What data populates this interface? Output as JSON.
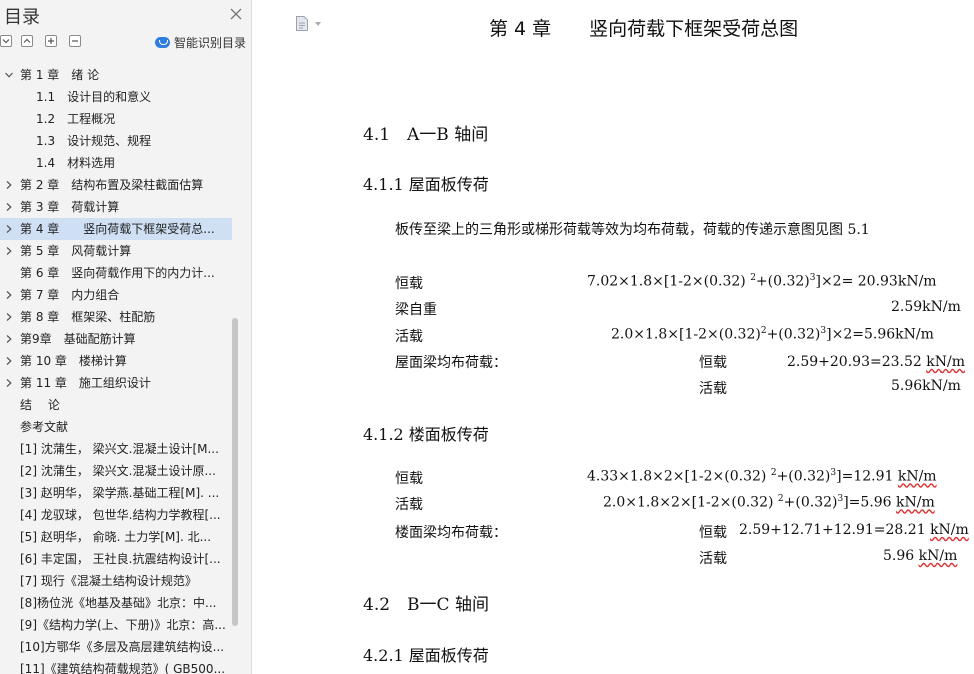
{
  "sidebar": {
    "title": "目录",
    "smart_label": "智能识别目录",
    "items": [
      {
        "text": "第 1 章　绪  论",
        "level": 0,
        "chevron": "down"
      },
      {
        "text": "1.1　设计目的和意义",
        "level": 1,
        "chevron": "none"
      },
      {
        "text": "1.2　工程概况",
        "level": 1,
        "chevron": "none"
      },
      {
        "text": "1.3　设计规范、规程",
        "level": 1,
        "chevron": "none"
      },
      {
        "text": "1.4　材料选用",
        "level": 1,
        "chevron": "none"
      },
      {
        "text": "第 2 章　结构布置及梁柱截面估算",
        "level": 0,
        "chevron": "right"
      },
      {
        "text": "第 3 章　荷载计算",
        "level": 0,
        "chevron": "right"
      },
      {
        "text": "第 4 章　　竖向荷载下框架受荷总...",
        "level": 0,
        "chevron": "right",
        "selected": true
      },
      {
        "text": "第 5 章　风荷载计算",
        "level": 0,
        "chevron": "right"
      },
      {
        "text": "第 6 章　竖向荷载作用下的内力计...",
        "level": 0,
        "chevron": "none"
      },
      {
        "text": "第 7 章　内力组合",
        "level": 0,
        "chevron": "right"
      },
      {
        "text": "第 8 章　框架梁、柱配筋",
        "level": 0,
        "chevron": "right"
      },
      {
        "text": "第9章　基础配筋计算",
        "level": 0,
        "chevron": "right"
      },
      {
        "text": "第 10 章　楼梯计算",
        "level": 0,
        "chevron": "right"
      },
      {
        "text": "第 11 章　施工组织设计",
        "level": 0,
        "chevron": "right"
      },
      {
        "text": "结　 论",
        "level": 0,
        "chevron": "none"
      },
      {
        "text": "参考文献",
        "level": 0,
        "chevron": "none"
      },
      {
        "text": "[1] 沈蒲生，  梁兴文.混凝土设计[M...",
        "level": 0,
        "chevron": "none"
      },
      {
        "text": "[2] 沈蒲生，  梁兴文.混凝土设计原...",
        "level": 0,
        "chevron": "none"
      },
      {
        "text": "[3] 赵明华，  梁学燕.基础工程[M].  ...",
        "level": 0,
        "chevron": "none"
      },
      {
        "text": "[4] 龙驭球，  包世华.结构力学教程[...",
        "level": 0,
        "chevron": "none"
      },
      {
        "text": "[5] 赵明华，  俞晓.  土力学[M].  北...",
        "level": 0,
        "chevron": "none"
      },
      {
        "text": "[6] 丰定国，  王社良.抗震结构设计[...",
        "level": 0,
        "chevron": "none"
      },
      {
        "text": "[7] 现行《混凝土结构设计规范》",
        "level": 0,
        "chevron": "none"
      },
      {
        "text": "[8]杨位洸《地基及基础》北京：中...",
        "level": 0,
        "chevron": "none"
      },
      {
        "text": "[9]《结构力学(上、下册)》北京：高...",
        "level": 0,
        "chevron": "none"
      },
      {
        "text": "[10]方鄂华《多层及高层建筑结构设...",
        "level": 0,
        "chevron": "none"
      },
      {
        "text": "[11]《建筑结构荷载规范》( GB500...",
        "level": 0,
        "chevron": "none"
      }
    ]
  },
  "document": {
    "chapter_title": "第 4 章　　竖向荷载下框架受荷总图",
    "sec_41": "4.1　A一B 轴间",
    "sec_411": "4.1.1 屋面板传荷",
    "intro": "板传至梁上的三角形或梯形荷载等效为均布荷载，荷载的传递示意图见图 5.1",
    "roof": {
      "dead_label": "恒载",
      "dead_formula_a": "7.02×1.8×[1-2×(0.32) ",
      "dead_formula_b": "+(0.32)",
      "dead_formula_c": "]×2= 20.93kN/m",
      "self_label": "梁自重",
      "self_value": "2.59kN/m",
      "live_label": "活载",
      "live_formula_a": "2.0×1.8×[1-2×(0.32)",
      "live_formula_b": "+(0.32)",
      "live_formula_c": "]×2=5.96kN/m",
      "uniform_label": "屋面梁均布荷载：",
      "u_dead_label": "恒载",
      "u_dead_value_a": "2.59+20.93=23.52 ",
      "u_dead_value_b": "kN/m",
      "u_live_label": "活载",
      "u_live_value": "5.96kN/m"
    },
    "sec_412": "4.1.2 楼面板传荷",
    "floor": {
      "dead_label": "恒载",
      "dead_formula_a": "4.33×1.8×2×[1-2×(0.32) ",
      "dead_formula_b": "+(0.32)",
      "dead_formula_c": "]=12.91 ",
      "dead_unit": "kN/m",
      "live_label": "活载",
      "live_formula_a": "2.0×1.8×2×[1-2×(0.32) ",
      "live_formula_b": "+(0.32)",
      "live_formula_c": "]=5.96 ",
      "live_unit": "kN/m",
      "uniform_label": "楼面梁均布荷载：",
      "u_dead_label": "恒载",
      "u_dead_value_a": "2.59+12.71+12.91=28.21 ",
      "u_dead_value_b": "kN/m",
      "u_live_label": "活载",
      "u_live_value_a": "5.96 ",
      "u_live_value_b": "kN/m"
    },
    "sec_42": "4.2　B一C 轴间",
    "sec_421": "4.2.1 屋面板传荷",
    "sup2": "2",
    "sup3": "3"
  },
  "icons": {
    "close": "close-icon",
    "collapse": "collapse-all-icon",
    "expand": "expand-all-icon",
    "add": "add-heading-icon",
    "remove": "remove-heading-icon",
    "smart": "cloud-icon",
    "page": "page-icon"
  }
}
